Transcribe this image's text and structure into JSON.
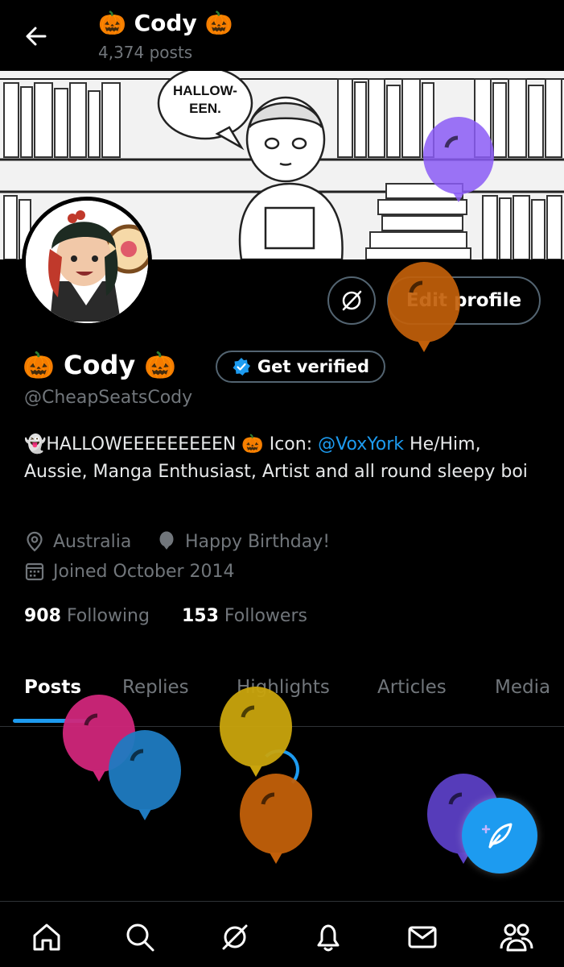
{
  "header": {
    "title": "🎃 Cody 🎃",
    "post_count": "4,374 posts"
  },
  "banner": {
    "speech_bubble_line1": "HALLOW-",
    "speech_bubble_line2": "EEN."
  },
  "actions": {
    "edit_profile_label": "Edit profile",
    "get_verified_label": "Get verified"
  },
  "profile": {
    "display_name": "🎃 Cody 🎃",
    "handle": "@CheapSeatsCody",
    "bio_part1": "👻HALLOWEEEEEEEEEN 🎃 Icon: ",
    "bio_link": "@VoxYork",
    "bio_part2": "  He/Him, Aussie, Manga Enthusiast, Artist and all round sleepy boi",
    "location": "Australia",
    "birthday": "Happy Birthday!",
    "joined": "Joined October 2014",
    "following_count": "908",
    "following_label": "Following",
    "followers_count": "153",
    "followers_label": "Followers"
  },
  "tabs": [
    {
      "label": "Posts",
      "active": true
    },
    {
      "label": "Replies"
    },
    {
      "label": "Highlights"
    },
    {
      "label": "Articles"
    },
    {
      "label": "Media"
    }
  ],
  "bottom_nav": [
    "home-icon",
    "search-icon",
    "grok-icon",
    "notifications-icon",
    "messages-icon",
    "communities-icon"
  ],
  "colors": {
    "accent": "#1d9bf0",
    "muted": "#71767b",
    "border": "#536471",
    "balloon_purple": "#8b5cf6",
    "balloon_orange": "#c2600a",
    "balloon_pink": "#d0267a",
    "balloon_blue": "#1f7bc1",
    "balloon_yellow": "#c9a40d",
    "balloon_indigo": "#5b3fc4"
  }
}
